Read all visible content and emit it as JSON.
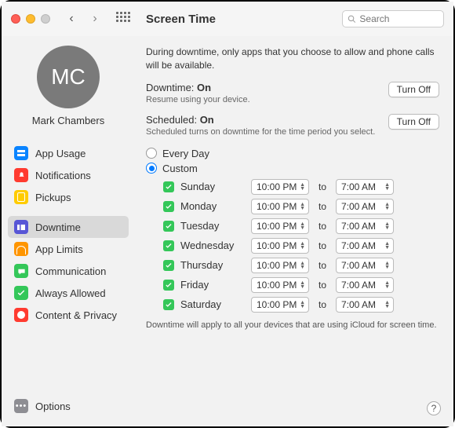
{
  "window": {
    "title": "Screen Time"
  },
  "search": {
    "placeholder": "Search"
  },
  "user": {
    "initials": "MC",
    "name": "Mark Chambers"
  },
  "sidebar": {
    "items": [
      {
        "label": "App Usage",
        "icon": "app-usage-icon"
      },
      {
        "label": "Notifications",
        "icon": "notifications-icon"
      },
      {
        "label": "Pickups",
        "icon": "pickups-icon"
      },
      {
        "label": "Downtime",
        "icon": "downtime-icon",
        "selected": true
      },
      {
        "label": "App Limits",
        "icon": "app-limits-icon"
      },
      {
        "label": "Communication",
        "icon": "communication-icon"
      },
      {
        "label": "Always Allowed",
        "icon": "always-allowed-icon"
      },
      {
        "label": "Content & Privacy",
        "icon": "content-privacy-icon"
      }
    ],
    "options_label": "Options"
  },
  "main": {
    "description": "During downtime, only apps that you choose to allow and phone calls will be available.",
    "downtime": {
      "label": "Downtime:",
      "status": "On",
      "sub": "Resume using your device.",
      "button": "Turn Off"
    },
    "scheduled": {
      "label": "Scheduled:",
      "status": "On",
      "sub": "Scheduled turns on downtime for the time period you select.",
      "button": "Turn Off"
    },
    "mode": {
      "every_day": "Every Day",
      "custom": "Custom",
      "selected": "Custom"
    },
    "to_label": "to",
    "days": [
      {
        "name": "Sunday",
        "enabled": true,
        "start": "10:00 PM",
        "end": "7:00 AM"
      },
      {
        "name": "Monday",
        "enabled": true,
        "start": "10:00 PM",
        "end": "7:00 AM"
      },
      {
        "name": "Tuesday",
        "enabled": true,
        "start": "10:00 PM",
        "end": "7:00 AM"
      },
      {
        "name": "Wednesday",
        "enabled": true,
        "start": "10:00 PM",
        "end": "7:00 AM"
      },
      {
        "name": "Thursday",
        "enabled": true,
        "start": "10:00 PM",
        "end": "7:00 AM"
      },
      {
        "name": "Friday",
        "enabled": true,
        "start": "10:00 PM",
        "end": "7:00 AM"
      },
      {
        "name": "Saturday",
        "enabled": true,
        "start": "10:00 PM",
        "end": "7:00 AM"
      }
    ],
    "footer": "Downtime will apply to all your devices that are using iCloud for screen time."
  }
}
